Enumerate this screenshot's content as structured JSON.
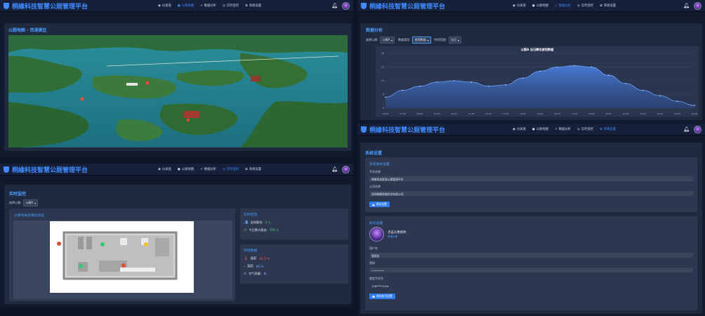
{
  "app": {
    "title": "桐緣科技智慧公厕管理平台"
  },
  "nav": {
    "dashboard": "仪表盘",
    "map": "公厕地图",
    "analysis": "数据分析",
    "monitor": "实时监控",
    "settings": "系统设置"
  },
  "map_view": {
    "panel_title": "公厕地图 - 西湖景区"
  },
  "analysis_view": {
    "panel_title": "数据分析",
    "filter_toilet_label": "选择公厕:",
    "filter_toilet_value": "公厕A",
    "filter_type_label": "数据类型:",
    "filter_type_value": "使用数据",
    "filter_time_label": "时间范围:",
    "filter_time_value": "当日"
  },
  "monitor_view": {
    "panel_title": "实时监控",
    "select_label": "选择公厕:",
    "select_value": "公厕A",
    "layout_title": "公厕布局及蹲位状态",
    "stats_title": "实时客流",
    "current_people_label": "当前客流:",
    "current_people_value": "3 人",
    "today_people_label": "今日累计客流:",
    "today_people_value": "150 人",
    "env_title": "环境数据",
    "temp_label": "温度:",
    "temp_value": "25.1 ℃",
    "humidity_label": "湿度:",
    "humidity_value": "60 %",
    "air_label": "空气质量:",
    "air_value": "良"
  },
  "settings_view": {
    "panel_title": "系统设置",
    "basic_title": "系统基本设置",
    "platform_name_label": "平台名称",
    "platform_name_value": "桐緣科技智慧公厕管理平台",
    "company_label": "公司名称",
    "company_value": "深圳桐緣智能科技有限公司",
    "save_btn": "保存设置",
    "account_title": "账号设置",
    "avatar_hint": "点击头像修改",
    "avatar_sub": "更换头像",
    "username_label": "用户名",
    "username_value": "管理员",
    "password_label": "密码",
    "password_value": "••••••••",
    "phone_label": "绑定手机号",
    "phone_value": "139****1234",
    "save_account_btn": "保存账号设置"
  },
  "colors": {
    "accent": "#3f8bff",
    "panel": "#202a3f",
    "background": "#111a2c",
    "occupied": "#e74c3c",
    "free": "#2ecc71",
    "cleaning": "#f1c40f"
  },
  "chart_data": {
    "type": "area",
    "title": "公厕A 当日蹲位使用数据",
    "xlabel": "",
    "ylabel": "",
    "x": [
      "06:00",
      "07:00",
      "08:00",
      "09:00",
      "10:00",
      "11:00",
      "12:00",
      "13:00",
      "14:00",
      "15:00",
      "16:00",
      "17:00",
      "18:00",
      "19:00",
      "20:00",
      "21:00",
      "22:00",
      "23:00",
      "24:00"
    ],
    "values": [
      4,
      6.5,
      8,
      9.5,
      10,
      9.5,
      8,
      8.5,
      11,
      13.5,
      15,
      15.5,
      15,
      12,
      9,
      6.5,
      4.5,
      2.5,
      1
    ],
    "ylim": [
      0,
      20
    ],
    "yticks": [
      "20",
      "15",
      "10",
      "5",
      "0"
    ],
    "grid": true
  }
}
